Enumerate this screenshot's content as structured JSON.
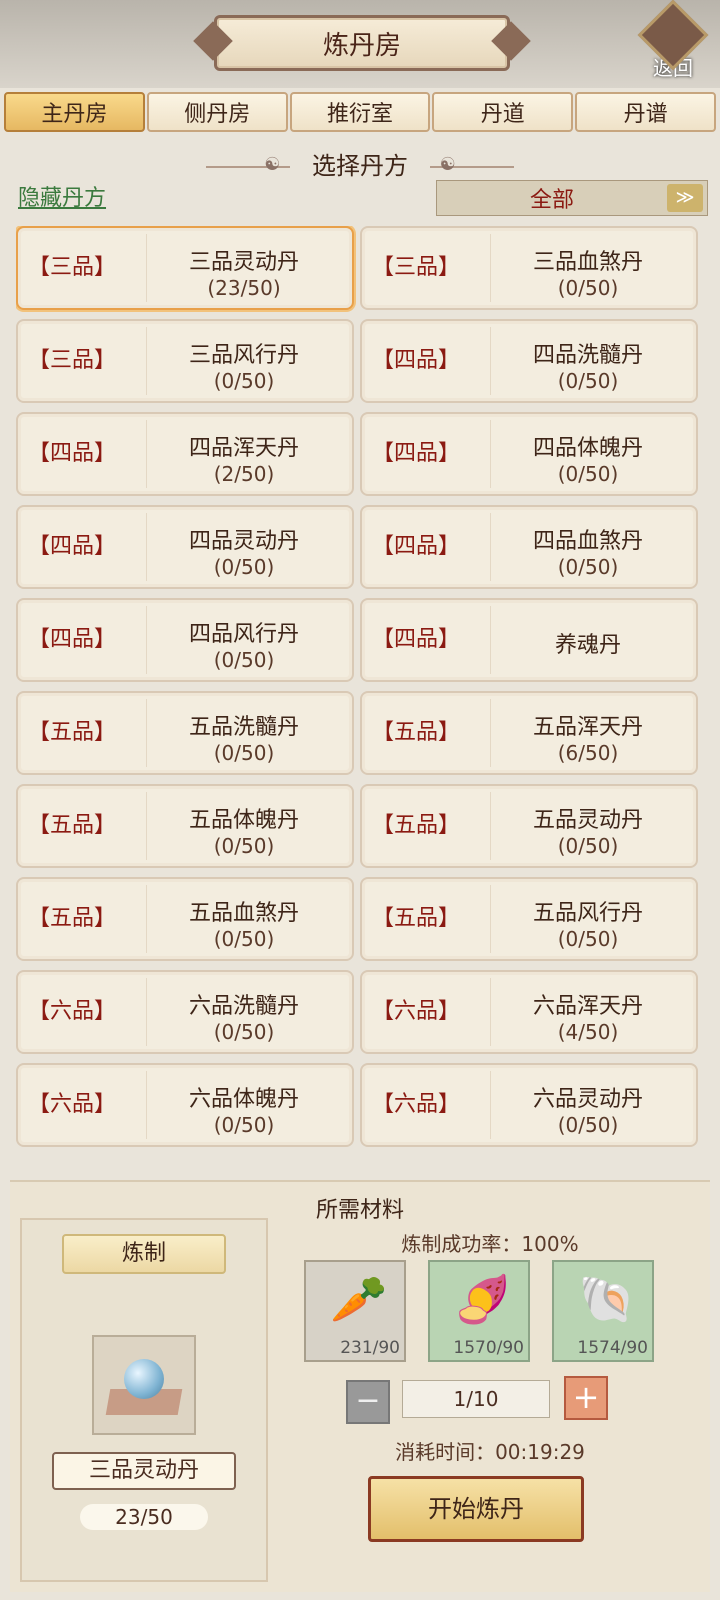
{
  "header": {
    "title": "炼丹房",
    "back_label": "返回"
  },
  "tabs": [
    "主丹房",
    "侧丹房",
    "推衍室",
    "丹道",
    "丹谱"
  ],
  "active_tab": 0,
  "section_title": "选择丹方",
  "hide_link": "隐藏丹方",
  "filter": {
    "value": "全部"
  },
  "recipes": [
    {
      "grade": "【三品】",
      "name": "三品灵动丹",
      "count": "(23/50)",
      "selected": true
    },
    {
      "grade": "【三品】",
      "name": "三品血煞丹",
      "count": "(0/50)"
    },
    {
      "grade": "【三品】",
      "name": "三品风行丹",
      "count": "(0/50)"
    },
    {
      "grade": "【四品】",
      "name": "四品洗髓丹",
      "count": "(0/50)"
    },
    {
      "grade": "【四品】",
      "name": "四品浑天丹",
      "count": "(2/50)"
    },
    {
      "grade": "【四品】",
      "name": "四品体魄丹",
      "count": "(0/50)"
    },
    {
      "grade": "【四品】",
      "name": "四品灵动丹",
      "count": "(0/50)"
    },
    {
      "grade": "【四品】",
      "name": "四品血煞丹",
      "count": "(0/50)"
    },
    {
      "grade": "【四品】",
      "name": "四品风行丹",
      "count": "(0/50)"
    },
    {
      "grade": "【四品】",
      "name": "养魂丹",
      "count": ""
    },
    {
      "grade": "【五品】",
      "name": "五品洗髓丹",
      "count": "(0/50)"
    },
    {
      "grade": "【五品】",
      "name": "五品浑天丹",
      "count": "(6/50)"
    },
    {
      "grade": "【五品】",
      "name": "五品体魄丹",
      "count": "(0/50)"
    },
    {
      "grade": "【五品】",
      "name": "五品灵动丹",
      "count": "(0/50)"
    },
    {
      "grade": "【五品】",
      "name": "五品血煞丹",
      "count": "(0/50)"
    },
    {
      "grade": "【五品】",
      "name": "五品风行丹",
      "count": "(0/50)"
    },
    {
      "grade": "【六品】",
      "name": "六品洗髓丹",
      "count": "(0/50)"
    },
    {
      "grade": "【六品】",
      "name": "六品浑天丹",
      "count": "(4/50)"
    },
    {
      "grade": "【六品】",
      "name": "六品体魄丹",
      "count": "(0/50)"
    },
    {
      "grade": "【六品】",
      "name": "六品灵动丹",
      "count": "(0/50)"
    }
  ],
  "materials_panel": {
    "title": "所需材料",
    "refine_label": "炼制",
    "pill_name": "三品灵动丹",
    "pill_count": "23/50",
    "success_rate": "炼制成功率：100%",
    "materials": [
      {
        "icon": "ginseng-root-icon",
        "count": "231/90",
        "style": "gray"
      },
      {
        "icon": "purple-root-icon",
        "count": "1570/90",
        "style": "green"
      },
      {
        "icon": "coiled-root-icon",
        "count": "1574/90",
        "style": "green"
      }
    ],
    "quantity": "1/10",
    "time": "消耗时间：00:19:29",
    "start_label": "开始炼丹"
  }
}
